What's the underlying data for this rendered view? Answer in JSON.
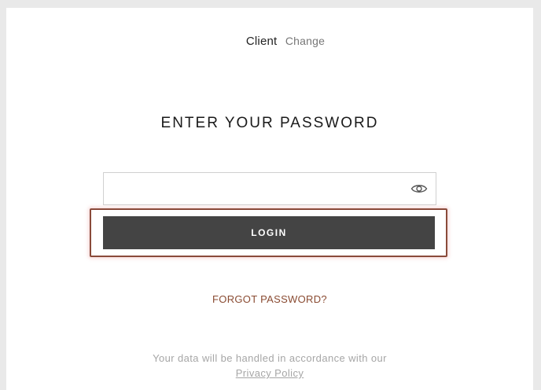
{
  "account": {
    "label": "Client",
    "change_label": "Change"
  },
  "form": {
    "heading": "ENTER YOUR PASSWORD",
    "password_value": "",
    "password_placeholder": "",
    "login_label": "LOGIN",
    "forgot_label": "FORGOT PASSWORD?"
  },
  "footer": {
    "notice": "Your data will be handled in accordance with our",
    "privacy_label": "Privacy Policy"
  },
  "icons": {
    "visibility_toggle": "eye-icon"
  },
  "colors": {
    "login_button": "#444444",
    "forgot_link": "#8a4b32",
    "highlight_border": "#8a4a3a"
  }
}
